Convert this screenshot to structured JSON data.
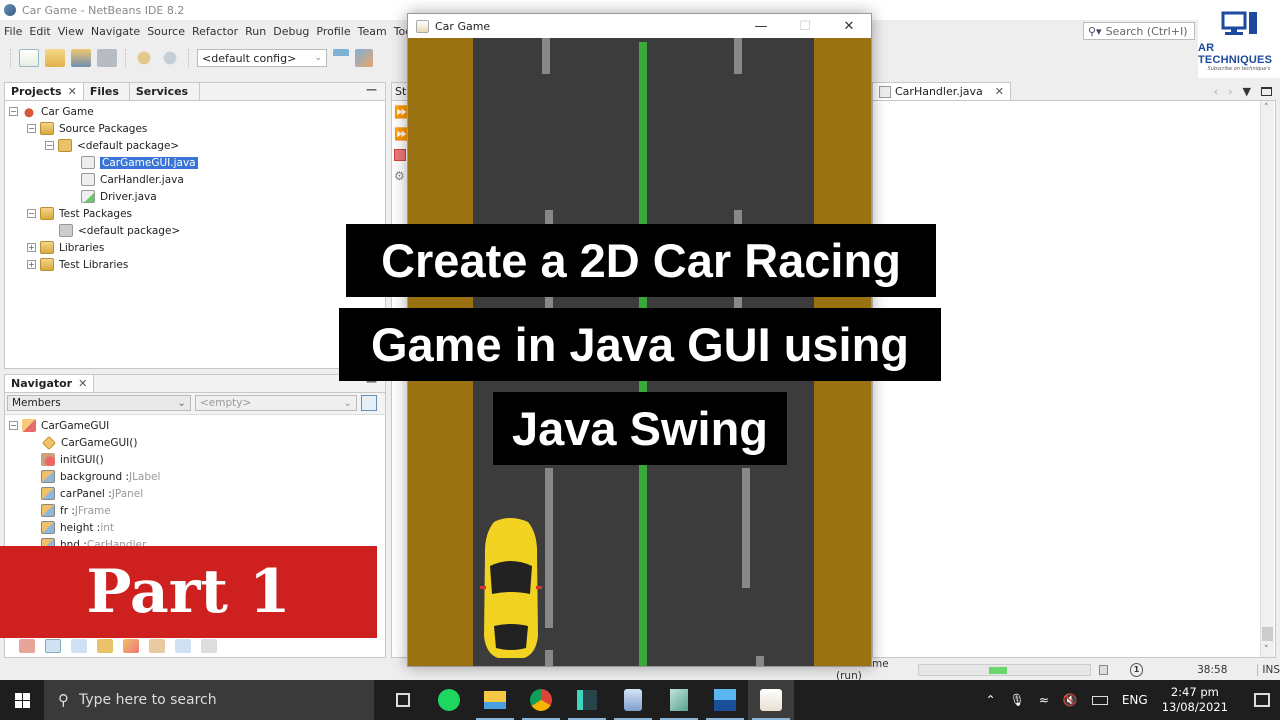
{
  "ide": {
    "window_title": "Car Game - NetBeans IDE 8.2",
    "menu": [
      "File",
      "Edit",
      "View",
      "Navigate",
      "Source",
      "Refactor",
      "Run",
      "Debug",
      "Profile",
      "Team",
      "Tools"
    ],
    "toolbar": {
      "config_value": "<default config>"
    },
    "search_placeholder": "Search (Ctrl+I)",
    "projects_panel": {
      "tabs": [
        "Projects",
        "Files",
        "Services"
      ],
      "tree": [
        {
          "label": "Car Game",
          "level": 0,
          "icon": "project-icon",
          "toggle": "-"
        },
        {
          "label": "Source Packages",
          "level": 1,
          "icon": "folder-icon",
          "toggle": "-"
        },
        {
          "label": "<default package>",
          "level": 2,
          "icon": "package-icon",
          "toggle": "-"
        },
        {
          "label": "CarGameGUI.java",
          "level": 3,
          "icon": "java-file-icon",
          "selected": true
        },
        {
          "label": "CarHandler.java",
          "level": 3,
          "icon": "java-file-icon"
        },
        {
          "label": "Driver.java",
          "level": 3,
          "icon": "java-main-file-icon"
        },
        {
          "label": "Test Packages",
          "level": 1,
          "icon": "folder-icon",
          "toggle": "-"
        },
        {
          "label": "<default package>",
          "level": 2,
          "icon": "empty-package-icon"
        },
        {
          "label": "Libraries",
          "level": 1,
          "icon": "library-folder-icon",
          "toggle": "+"
        },
        {
          "label": "Test Libraries",
          "level": 1,
          "icon": "library-folder-icon",
          "toggle": "+"
        }
      ]
    },
    "navigator_panel": {
      "title": "Navigator",
      "members_select": "Members",
      "filter_select": "<empty>",
      "tree": [
        {
          "name": "CarGameGUI",
          "type": "",
          "kind": "class"
        },
        {
          "name": "CarGameGUI()",
          "type": "",
          "kind": "constructor"
        },
        {
          "name": "initGUI()",
          "type": "",
          "kind": "method"
        },
        {
          "name": "background : ",
          "type": "JLabel",
          "kind": "field"
        },
        {
          "name": "carPanel : ",
          "type": "JPanel",
          "kind": "field"
        },
        {
          "name": "fr : ",
          "type": "JFrame",
          "kind": "field"
        },
        {
          "name": "height : ",
          "type": "int",
          "kind": "field"
        },
        {
          "name": "hnd : ",
          "type": "CarHandler",
          "kind": "field"
        }
      ]
    },
    "output_partial_tab": "Sta",
    "editor_tab": "CarHandler.java",
    "status": {
      "run_label": "Car Game (run)",
      "notifications": "1",
      "position": "38:58",
      "mode": "INS"
    }
  },
  "game_window": {
    "title": "Car Game",
    "colors": {
      "grass": "#9a7212",
      "road": "#3c3c3c",
      "center_line": "#3aa83a",
      "lane_mark": "#888888",
      "car": "#f2d321"
    }
  },
  "overlay": {
    "caption_lines": [
      "Create a 2D Car Racing",
      "Game in Java GUI using",
      "Java Swing"
    ],
    "part_label": "Part 1",
    "logo_title": "AR TECHNIQUES",
    "logo_subtitle": "Subscribe on technique's"
  },
  "taskbar": {
    "search_placeholder": "Type here to search",
    "apps": [
      "task-view",
      "spotify",
      "file-explorer",
      "chrome",
      "filmora",
      "virtualbox",
      "notepad",
      "photos",
      "java"
    ],
    "tray": {
      "language": "ENG",
      "time": "2:47 pm",
      "date": "13/08/2021"
    }
  }
}
